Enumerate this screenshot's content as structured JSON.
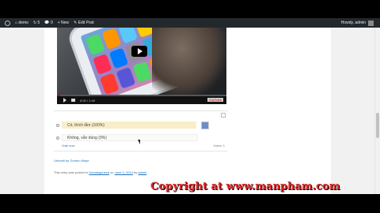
{
  "admin_bar": {
    "site_name": "demo",
    "updates_count": "5",
    "comments_count": "0",
    "new_label": "New",
    "edit_post_label": "Edit Post",
    "user_greeting": "Howdy, admin"
  },
  "video": {
    "time_display": "0:00 / 1:49",
    "brand_label": "YouTube"
  },
  "poll": {
    "options": [
      {
        "label": "Có, thích lắm  (100%)",
        "percent": 100
      },
      {
        "label": "Không, vẫn dùng  (0%)",
        "percent": 0
      }
    ],
    "view_results": "Vote now",
    "total_votes": "Votes: 1"
  },
  "powered_by": "Unicraft by Gordon Maye",
  "posted_prefix": "This entry was posted in",
  "posted_category": "Uncategorized",
  "posted_on": "on",
  "posted_date": "June 3, 2014",
  "posted_by": "by",
  "posted_author": "admin",
  "watermark": "Copyright at www.manpham.com"
}
